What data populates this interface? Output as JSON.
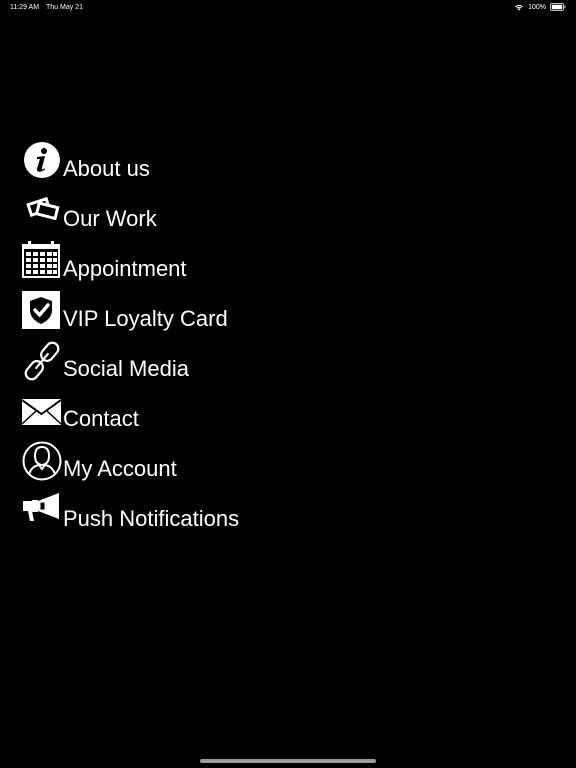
{
  "status_bar": {
    "time": "11:29 AM",
    "date": "Thu May 21",
    "battery": "100%",
    "wifi_icon": "wifi-icon",
    "battery_icon": "battery-icon"
  },
  "menu": {
    "items": [
      {
        "label": "About us",
        "icon": "info-icon"
      },
      {
        "label": "Our Work",
        "icon": "photos-icon"
      },
      {
        "label": "Appointment",
        "icon": "calendar-icon"
      },
      {
        "label": "VIP Loyalty Card",
        "icon": "shield-check-icon"
      },
      {
        "label": "Social Media",
        "icon": "link-icon"
      },
      {
        "label": "Contact",
        "icon": "envelope-icon"
      },
      {
        "label": "My Account",
        "icon": "user-icon"
      },
      {
        "label": "Push Notifications",
        "icon": "megaphone-icon"
      }
    ]
  },
  "colors": {
    "background": "#000000",
    "text": "#ffffff",
    "home_indicator": "#9a9a9a"
  }
}
